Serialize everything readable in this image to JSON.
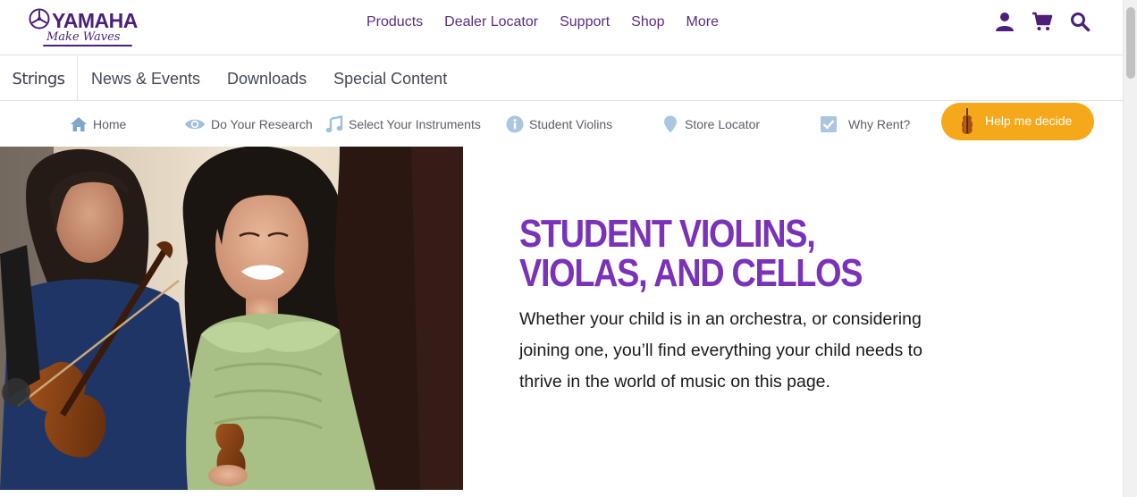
{
  "logo": {
    "brand": "YAMAHA",
    "tagline": "Make Waves"
  },
  "main_nav": [
    "Products",
    "Dealer Locator",
    "Support",
    "Shop",
    "More"
  ],
  "utility_icons": [
    "user-icon",
    "cart-icon",
    "search-icon"
  ],
  "section_nav": {
    "brand": "Strings",
    "links": [
      "News & Events",
      "Downloads",
      "Special Content"
    ]
  },
  "sub_nav": [
    {
      "label": "Home",
      "icon": "home-icon"
    },
    {
      "label": "Do Your Research",
      "icon": "eye-icon"
    },
    {
      "label": "Select Your Instruments",
      "icon": "music-note-icon"
    },
    {
      "label": "Student Violins",
      "icon": "info-icon"
    },
    {
      "label": "Store Locator",
      "icon": "map-pin-icon"
    },
    {
      "label": "Why Rent?",
      "icon": "checkbox-icon"
    }
  ],
  "help_button": {
    "label": "Help me decide",
    "icon": "violin-icon"
  },
  "hero": {
    "title": "STUDENT VIOLINS, VIOLAS, AND CELLOS",
    "body": "Whether your child is in an orchestra, or considering joining one, you’ll find everything your child needs to thrive in the world of music on this page."
  },
  "colors": {
    "brand_purple": "#5a2d82",
    "title_purple": "#7a32b8",
    "accent_orange": "#f5a91a",
    "icon_light_blue": "#9fc0dc"
  }
}
